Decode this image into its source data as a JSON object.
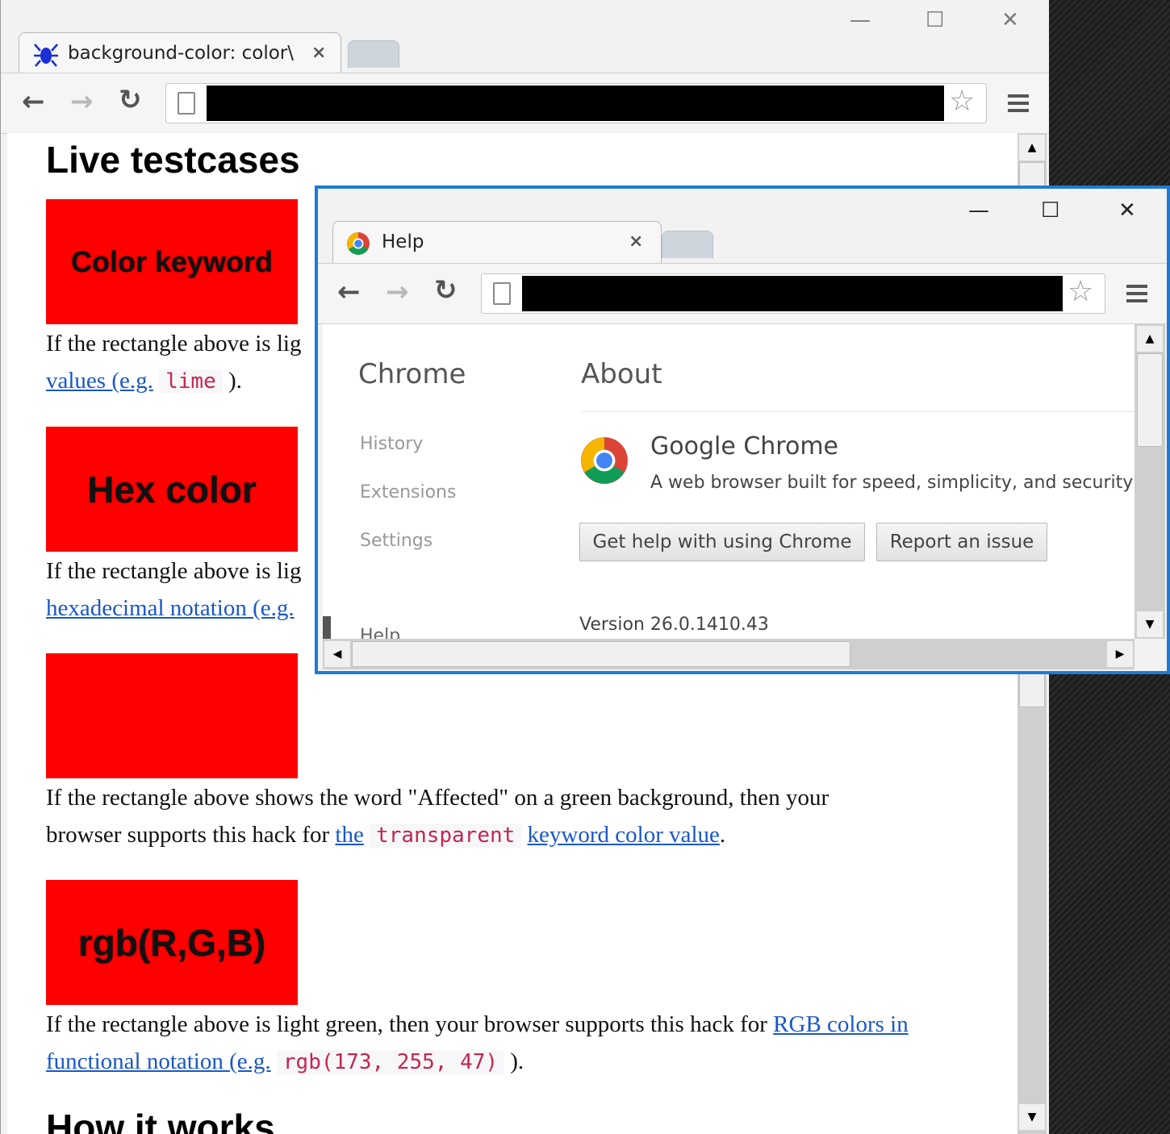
{
  "back_window": {
    "tab_title": "background-color: color\\",
    "tab_close": "×",
    "controls": {
      "minimize": "—",
      "maximize": "☐",
      "close": "✕"
    },
    "page": {
      "heading": "Live testcases",
      "boxes": [
        {
          "label": "Color keyword"
        },
        {
          "label": "Hex color"
        },
        {
          "label": ""
        },
        {
          "label": "rgb(R,G,B)"
        }
      ],
      "p1_line1": "If the rectangle above is lig",
      "p1_link": "values (e.g.",
      "p1_code": "lime",
      "p1_tail": ").",
      "p2_line1": "If the rectangle above is lig",
      "p2_link": "hexadecimal notation (e.g.",
      "p3_line1": "If the rectangle above shows the word \"Affected\" on a green background, then your",
      "p3_line2_pre": "browser supports this hack for",
      "p3_link_a": "the",
      "p3_code": "transparent",
      "p3_link_b": "keyword color value",
      "p3_tail": ".",
      "p4_line1_pre": "If the rectangle above is light green, then your browser supports this hack for",
      "p4_link_a": "RGB colors in",
      "p4_link_b": "functional notation (e.g.",
      "p4_code": "rgb(173, 255, 47)",
      "p4_tail": ").",
      "next_heading": "How it works"
    }
  },
  "front_window": {
    "tab_title": "Help",
    "tab_close": "×",
    "controls": {
      "minimize": "—",
      "maximize": "☐",
      "close": "✕"
    },
    "sidebar": {
      "title": "Chrome",
      "items": [
        "History",
        "Extensions",
        "Settings"
      ],
      "cut_item": "Help"
    },
    "main": {
      "title": "About",
      "product": "Google Chrome",
      "tagline": "A web browser built for speed, simplicity, and security",
      "help_button": "Get help with using Chrome",
      "report_button": "Report an issue",
      "version": "Version 26.0.1410.43"
    }
  },
  "colors": {
    "accent": "#1f7ad6",
    "box_red": "#ff0000",
    "link": "#1a57c9",
    "code": "#c7254e"
  }
}
